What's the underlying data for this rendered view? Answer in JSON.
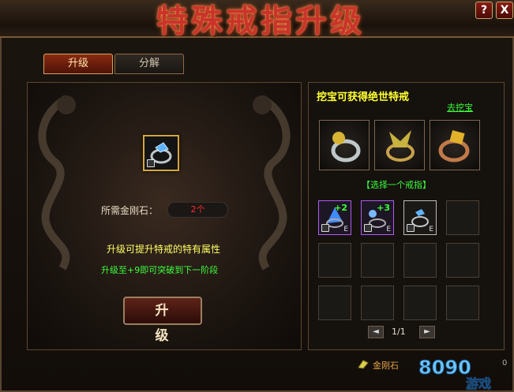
{
  "window": {
    "title": "特殊戒指升级",
    "help_label": "?",
    "close_label": "X"
  },
  "tabs": [
    {
      "label": "升级",
      "active": true
    },
    {
      "label": "分解",
      "active": false
    }
  ],
  "upgrade": {
    "required_label": "所需金刚石：",
    "required_count": "2个",
    "info_line1": "升级可提升特戒的特有属性",
    "info_line2": "升级至+9即可突破到下一阶段",
    "button_label": "升级"
  },
  "treasure": {
    "heading": "挖宝可获得绝世特戒",
    "link_label": "去挖宝",
    "select_label": "【选择一个戒指】"
  },
  "inventory": {
    "items": [
      {
        "plus": "+2",
        "rarity": "purple",
        "badge": "E"
      },
      {
        "plus": "+3",
        "rarity": "purple",
        "badge": "E"
      },
      {
        "plus": "",
        "rarity": "white",
        "badge": "E"
      }
    ],
    "page": "1/1",
    "prev_label": "◄",
    "next_label": "►"
  },
  "currency": {
    "label": "金刚石",
    "count": "0"
  },
  "watermark": {
    "text": "8090",
    "sub": "游戏"
  },
  "colors": {
    "accent_title": "#c9342a",
    "green_text": "#3cff3c",
    "yellow_text": "#ffff66",
    "red_count": "#ff2a2a"
  }
}
